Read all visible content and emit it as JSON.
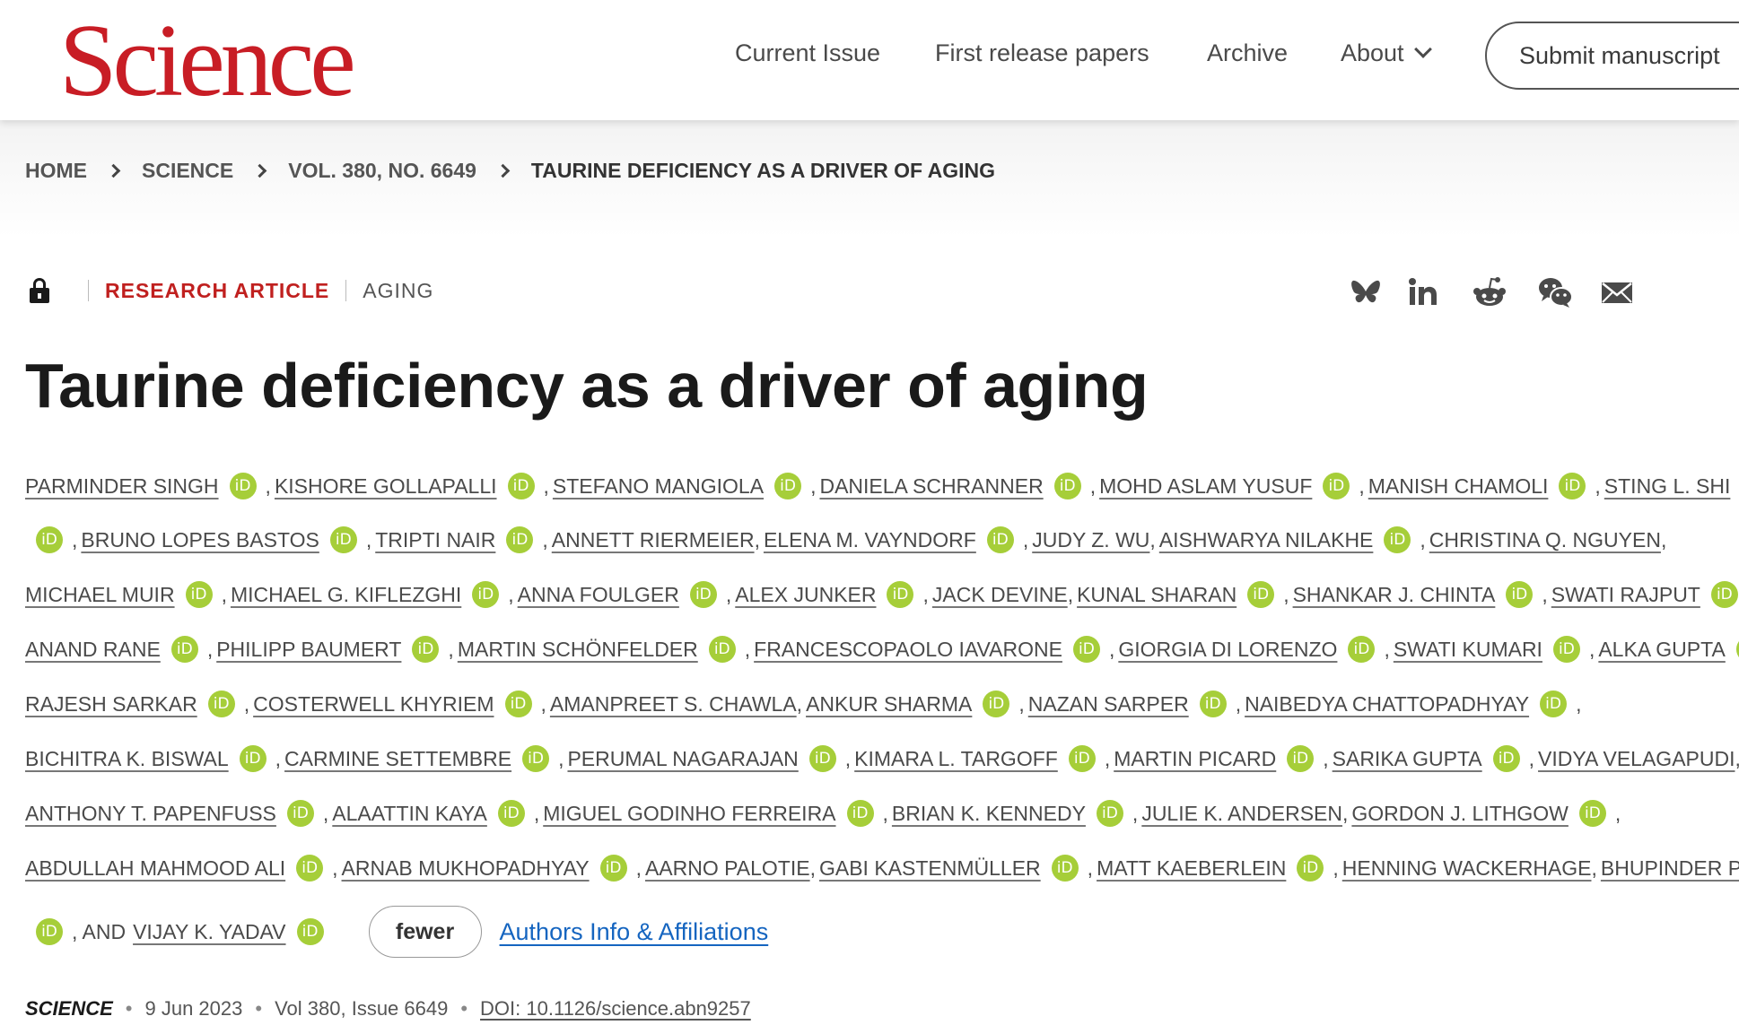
{
  "header": {
    "logo": "Science",
    "nav": [
      "Current Issue",
      "First release papers",
      "Archive",
      "About"
    ],
    "submit_label": "Submit manuscript"
  },
  "breadcrumb": [
    "HOME",
    "SCIENCE",
    "VOL. 380, NO. 6649",
    "TAURINE DEFICIENCY AS A DRIVER OF AGING"
  ],
  "article": {
    "access": "lock-icon",
    "type": "RESEARCH ARTICLE",
    "subject": "AGING",
    "title": "Taurine deficiency as a driver of aging",
    "share_icons": [
      "bluesky-icon",
      "linkedin-icon",
      "reddit-icon",
      "wechat-icon",
      "email-icon"
    ]
  },
  "authors": {
    "lines": [
      [
        [
          "PARMINDER SINGH",
          true,
          ","
        ],
        [
          "KISHORE GOLLAPALLI",
          true,
          ","
        ],
        [
          "STEFANO MANGIOLA",
          true,
          ","
        ],
        [
          "DANIELA SCHRANNER",
          true,
          ","
        ],
        [
          "MOHD ASLAM YUSUF",
          true,
          ","
        ],
        [
          "MANISH CHAMOLI",
          true,
          ","
        ],
        [
          "STING L. SHI",
          false,
          ""
        ]
      ],
      [
        [
          "",
          true,
          ","
        ],
        [
          "BRUNO LOPES BASTOS",
          true,
          ","
        ],
        [
          "TRIPTI NAIR",
          true,
          ","
        ],
        [
          "ANNETT RIERMEIER",
          false,
          ","
        ],
        [
          "ELENA M. VAYNDORF",
          true,
          ","
        ],
        [
          "JUDY Z. WU",
          false,
          ","
        ],
        [
          "AISHWARYA NILAKHE",
          true,
          ","
        ],
        [
          "CHRISTINA Q. NGUYEN",
          false,
          ","
        ]
      ],
      [
        [
          "MICHAEL MUIR",
          true,
          ","
        ],
        [
          "MICHAEL G. KIFLEZGHI",
          true,
          ","
        ],
        [
          "ANNA FOULGER",
          true,
          ","
        ],
        [
          "ALEX JUNKER",
          true,
          ","
        ],
        [
          "JACK DEVINE",
          false,
          ","
        ],
        [
          "KUNAL SHARAN",
          true,
          ","
        ],
        [
          "SHANKAR J. CHINTA",
          true,
          ","
        ],
        [
          "SWATI RAJPUT",
          true,
          ","
        ]
      ],
      [
        [
          "ANAND RANE",
          true,
          ","
        ],
        [
          "PHILIPP BAUMERT",
          true,
          ","
        ],
        [
          "MARTIN SCHÖNFELDER",
          true,
          ","
        ],
        [
          "FRANCESCOPAOLO IAVARONE",
          true,
          ","
        ],
        [
          "GIORGIA DI LORENZO",
          true,
          ","
        ],
        [
          "SWATI KUMARI",
          true,
          ","
        ],
        [
          "ALKA GUPTA",
          true,
          ","
        ]
      ],
      [
        [
          "RAJESH SARKAR",
          true,
          ","
        ],
        [
          "COSTERWELL KHYRIEM",
          true,
          ","
        ],
        [
          "AMANPREET S. CHAWLA",
          false,
          ","
        ],
        [
          "ANKUR SHARMA",
          true,
          ","
        ],
        [
          "NAZAN SARPER",
          true,
          ","
        ],
        [
          "NAIBEDYA CHATTOPADHYAY",
          true,
          ","
        ]
      ],
      [
        [
          "BICHITRA K. BISWAL",
          true,
          ","
        ],
        [
          "CARMINE SETTEMBRE",
          true,
          ","
        ],
        [
          "PERUMAL NAGARAJAN",
          true,
          ","
        ],
        [
          "KIMARA L. TARGOFF",
          true,
          ","
        ],
        [
          "MARTIN PICARD",
          true,
          ","
        ],
        [
          "SARIKA GUPTA",
          true,
          ","
        ],
        [
          "VIDYA VELAGAPUDI",
          false,
          ","
        ]
      ],
      [
        [
          "ANTHONY T. PAPENFUSS",
          true,
          ","
        ],
        [
          "ALAATTIN KAYA",
          true,
          ","
        ],
        [
          "MIGUEL GODINHO FERREIRA",
          true,
          ","
        ],
        [
          "BRIAN K. KENNEDY",
          true,
          ","
        ],
        [
          "JULIE K. ANDERSEN",
          false,
          ","
        ],
        [
          "GORDON J. LITHGOW",
          true,
          ","
        ]
      ],
      [
        [
          "ABDULLAH MAHMOOD ALI",
          true,
          ","
        ],
        [
          "ARNAB MUKHOPADHYAY",
          true,
          ","
        ],
        [
          "AARNO PALOTIE",
          false,
          ","
        ],
        [
          "GABI KASTENMÜLLER",
          true,
          ","
        ],
        [
          "MATT KAEBERLEIN",
          true,
          ","
        ],
        [
          "HENNING WACKERHAGE",
          false,
          ","
        ],
        [
          "BHUPINDER PAL",
          false,
          ""
        ]
      ]
    ],
    "last_prefix": ", AND",
    "last_author": "VIJAY K. YADAV",
    "orcid_label": "iD",
    "fewer_label": "fewer",
    "affiliations_label": "Authors Info & Affiliations"
  },
  "citation": {
    "journal": "SCIENCE",
    "date": "9 Jun 2023",
    "volume": "Vol 380, Issue 6649",
    "doi": "DOI: 10.1126/science.abn9257"
  },
  "colors": {
    "brand_red": "#c81d25",
    "orcid_green": "#a6ce39",
    "link_blue": "#1565c0"
  }
}
